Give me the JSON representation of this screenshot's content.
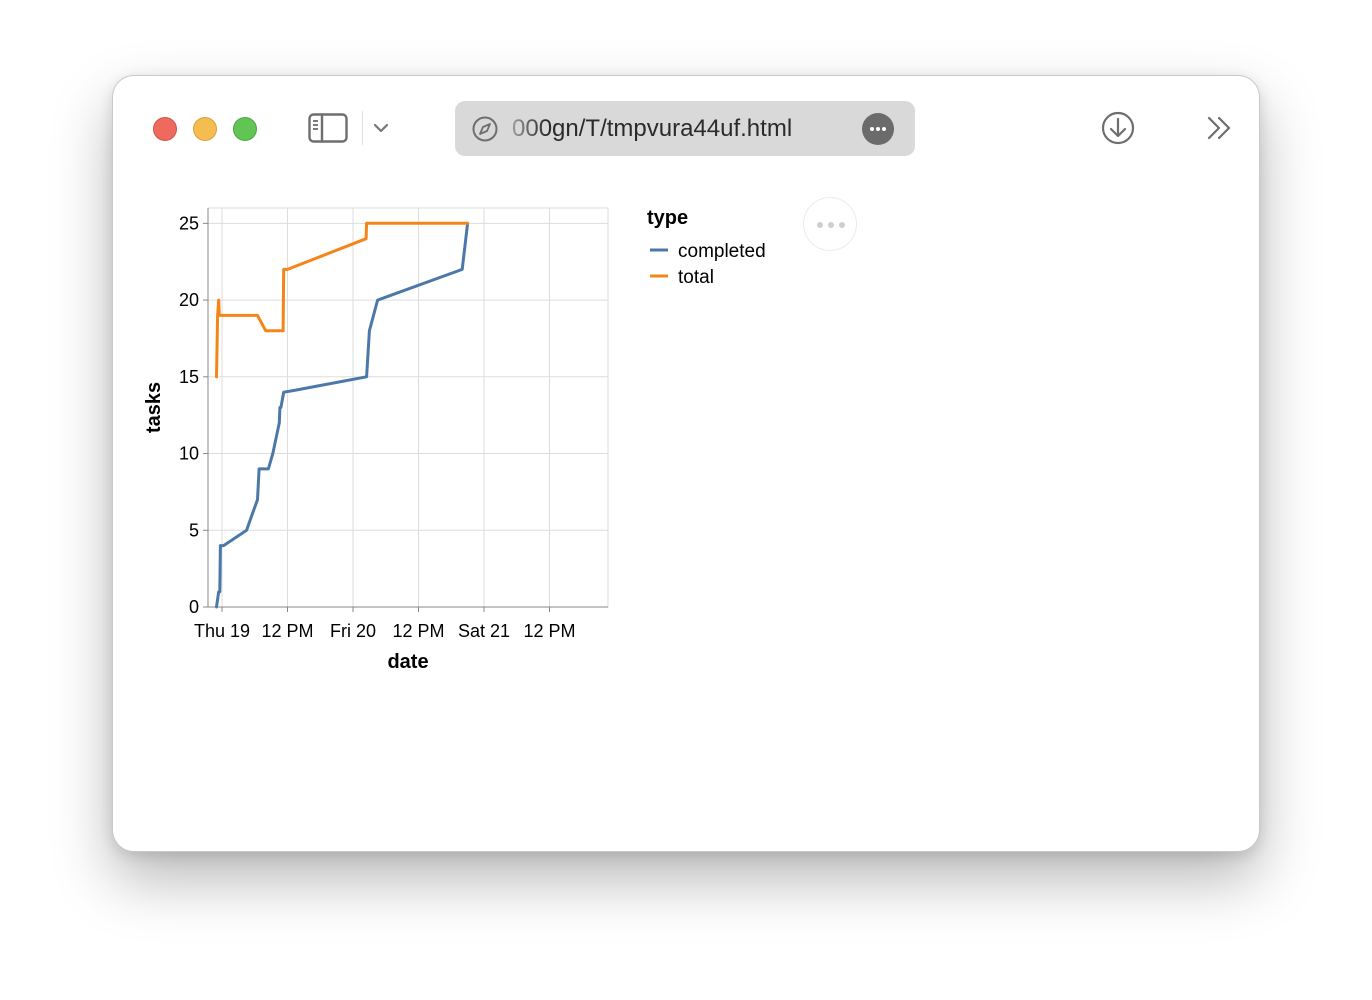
{
  "browser": {
    "url": "000gn/T/tmpvura44uf.html"
  },
  "chart_data": {
    "type": "line",
    "xlabel": "date",
    "ylabel": "tasks",
    "x_ticks": [
      "Thu 19",
      "12 PM",
      "Fri 20",
      "12 PM",
      "Sat 21",
      "12 PM"
    ],
    "y_ticks": [
      0,
      5,
      10,
      15,
      20,
      25
    ],
    "ylim": [
      0,
      26
    ],
    "xlim": [
      "Thu 19 ~ -1.0h",
      "Sat 22 ~ -5.0h"
    ],
    "grid": true,
    "legend": {
      "title": "type",
      "placement": "right"
    },
    "series": [
      {
        "name": "completed",
        "color": "#4c78a8",
        "points": [
          [
            -1.0,
            0
          ],
          [
            -0.6,
            1
          ],
          [
            -0.4,
            1
          ],
          [
            -0.3,
            4
          ],
          [
            0.3,
            4
          ],
          [
            4.5,
            5
          ],
          [
            5.5,
            6
          ],
          [
            6.5,
            7
          ],
          [
            6.8,
            9
          ],
          [
            8.5,
            9
          ],
          [
            9.3,
            10
          ],
          [
            10.5,
            12
          ],
          [
            10.6,
            13
          ],
          [
            10.8,
            13
          ],
          [
            11.3,
            14
          ],
          [
            13.0,
            14.1
          ],
          [
            26.5,
            15
          ],
          [
            27.0,
            18
          ],
          [
            28.5,
            20
          ],
          [
            44.0,
            22
          ],
          [
            45.0,
            25
          ]
        ]
      },
      {
        "name": "total",
        "color": "#f58518",
        "points": [
          [
            -1.0,
            15
          ],
          [
            -0.8,
            19
          ],
          [
            -0.6,
            20
          ],
          [
            -0.5,
            19
          ],
          [
            6.5,
            19
          ],
          [
            8.0,
            18
          ],
          [
            11.2,
            18
          ],
          [
            11.3,
            22
          ],
          [
            12.0,
            22
          ],
          [
            26.4,
            24
          ],
          [
            26.5,
            25
          ],
          [
            45.0,
            25
          ]
        ]
      }
    ]
  }
}
